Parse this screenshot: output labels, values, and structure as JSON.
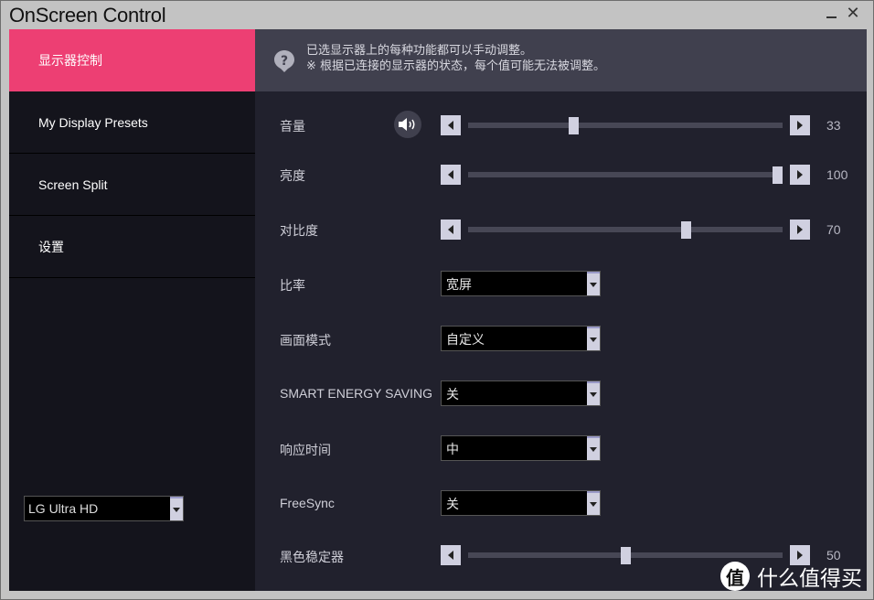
{
  "window": {
    "title": "OnScreen Control",
    "minimize_icon": "minimize-icon",
    "close_icon": "close-icon",
    "close_glyph": "✕"
  },
  "sidebar": {
    "items": [
      {
        "label": "显示器控制",
        "active": true
      },
      {
        "label": "My Display Presets",
        "active": false
      },
      {
        "label": "Screen Split",
        "active": false
      },
      {
        "label": "设置",
        "active": false
      }
    ],
    "monitor_select": {
      "value": "LG Ultra HD"
    }
  },
  "info": {
    "icon": "help-icon",
    "line1": "已选显示器上的每种功能都可以手动调整。",
    "line2": "※ 根据已连接的显示器的状态，每个值可能无法被调整。"
  },
  "controls": {
    "volume": {
      "label": "音量",
      "value": "33",
      "fraction": 0.33,
      "icon": "speaker-icon"
    },
    "brightness": {
      "label": "亮度",
      "value": "100",
      "fraction": 1.0
    },
    "contrast": {
      "label": "对比度",
      "value": "70",
      "fraction": 0.7
    },
    "ratio": {
      "label": "比率",
      "selected": "宽屏"
    },
    "picture_mode": {
      "label": "画面模式",
      "selected": "自定义"
    },
    "smart_energy_saving": {
      "label": "SMART ENERGY SAVING",
      "selected": "关"
    },
    "response_time": {
      "label": "响应时间",
      "selected": "中"
    },
    "freesync": {
      "label": "FreeSync",
      "selected": "关"
    },
    "black_stabilizer": {
      "label": "黑色稳定器",
      "value": "50",
      "fraction": 0.5
    }
  },
  "watermark": {
    "logo": "值",
    "text": "什么值得买"
  },
  "colors": {
    "accent": "#ed3f73",
    "sidebar_bg": "#14141c",
    "main_bg": "#21212d",
    "info_bg": "#40404e"
  }
}
